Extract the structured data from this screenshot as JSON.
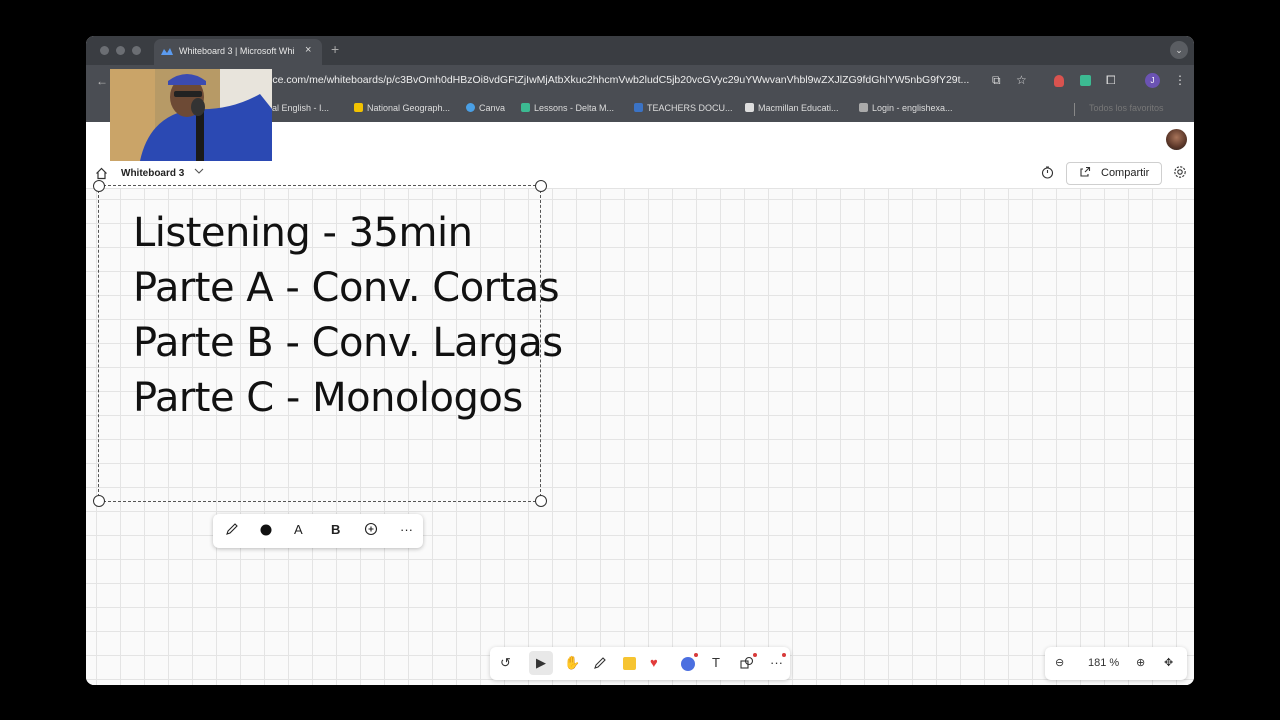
{
  "browser": {
    "tab_title": "Whiteboard 3 | Microsoft Whi",
    "tab_close": "×",
    "new_tab": "+",
    "tab_menu": "⌄",
    "url": "ice.com/me/whiteboards/p/c3BvOmh0dHBzOi8vdGFtZjIwMjAtbXkuc2hhcmVwb2ludC5jb20vcGVyc29uYWwvanVhbl9wZXJlZG9fdGhlYW5nbG9fY29t...",
    "bookmarks": [
      {
        "label": "eral English - I...",
        "color": "#888888"
      },
      {
        "label": "National Geograph...",
        "color": "#f2c200"
      },
      {
        "label": "Canva",
        "color": "#4aa0e6"
      },
      {
        "label": "Lessons - Delta M...",
        "color": "#3cba92"
      },
      {
        "label": "TEACHERS DOCU...",
        "color": "#3b73c5"
      },
      {
        "label": "Macmillan Educati...",
        "color": "#dddddd"
      },
      {
        "label": "Login - englishexa...",
        "color": "#aaaaaa"
      }
    ],
    "bookmarks_right": "Todos los favoritos",
    "profile_initial": "J"
  },
  "app": {
    "board_name": "Whiteboard 3",
    "share_label": "Compartir"
  },
  "canvas": {
    "lines": [
      "Listening - 35min",
      "Parte A - Conv. Cortas",
      "Parte B - Conv. Largas",
      "Parte C - Monologos"
    ]
  },
  "zoom": {
    "level": "181 %"
  },
  "icons": {
    "home": "home-icon",
    "chevron": "chevron-down-icon",
    "timer": "timer-icon",
    "share": "share-icon",
    "settings": "gear-icon"
  }
}
